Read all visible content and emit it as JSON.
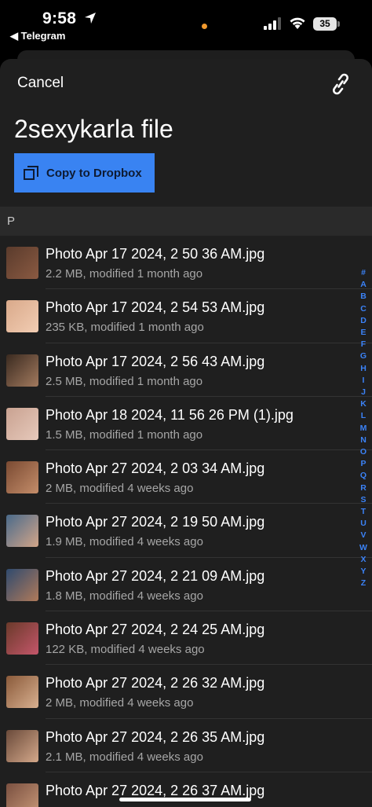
{
  "status_bar": {
    "time": "9:58",
    "back_app": "◀ Telegram",
    "battery": "35"
  },
  "header": {
    "cancel_label": "Cancel",
    "title": "2sexykarla file",
    "copy_button_label": "Copy to Dropbox"
  },
  "section": {
    "letter": "P"
  },
  "files": [
    {
      "name": "Photo Apr 17 2024, 2 50 36 AM.jpg",
      "meta": "2.2 MB, modified 1 month ago",
      "thumb": [
        "#5a3b2c",
        "#8a5a42"
      ]
    },
    {
      "name": "Photo Apr 17 2024, 2 54 53 AM.jpg",
      "meta": "235 KB, modified 1 month ago",
      "thumb": [
        "#d9a98a",
        "#f2cdb3"
      ]
    },
    {
      "name": "Photo Apr 17 2024, 2 56 43 AM.jpg",
      "meta": "2.5 MB, modified 1 month ago",
      "thumb": [
        "#3a2a20",
        "#a27a5e"
      ]
    },
    {
      "name": "Photo Apr 18 2024, 11 56 26 PM (1).jpg",
      "meta": "1.5 MB, modified 1 month ago",
      "thumb": [
        "#c9a291",
        "#e6c9bb"
      ]
    },
    {
      "name": "Photo Apr 27 2024, 2 03 34 AM.jpg",
      "meta": "2 MB, modified 4 weeks ago",
      "thumb": [
        "#7a4a32",
        "#c48d6a"
      ]
    },
    {
      "name": "Photo Apr 27 2024, 2 19 50 AM.jpg",
      "meta": "1.9 MB, modified 4 weeks ago",
      "thumb": [
        "#4a6a8a",
        "#d2a589"
      ]
    },
    {
      "name": "Photo Apr 27 2024, 2 21 09 AM.jpg",
      "meta": "1.8 MB, modified 4 weeks ago",
      "thumb": [
        "#2f4a6e",
        "#b07a5a"
      ]
    },
    {
      "name": "Photo Apr 27 2024, 2 24 25 AM.jpg",
      "meta": "122 KB, modified 4 weeks ago",
      "thumb": [
        "#6a3a2a",
        "#c4566a"
      ]
    },
    {
      "name": "Photo Apr 27 2024, 2 26 32 AM.jpg",
      "meta": "2 MB, modified 4 weeks ago",
      "thumb": [
        "#8a5a3a",
        "#d8b090"
      ]
    },
    {
      "name": "Photo Apr 27 2024, 2 26 35 AM.jpg",
      "meta": "2.1 MB, modified 4 weeks ago",
      "thumb": [
        "#6a4a3a",
        "#d4a88a"
      ]
    },
    {
      "name": "Photo Apr 27 2024, 2 26 37 AM.jpg",
      "meta": "",
      "thumb": [
        "#7a5040",
        "#c89878"
      ]
    }
  ],
  "index_letters": [
    "#",
    "A",
    "B",
    "C",
    "D",
    "E",
    "F",
    "G",
    "H",
    "I",
    "J",
    "K",
    "L",
    "M",
    "N",
    "O",
    "P",
    "Q",
    "R",
    "S",
    "T",
    "U",
    "V",
    "W",
    "X",
    "Y",
    "Z"
  ],
  "colors": {
    "accent": "#3983f2",
    "index": "#3b82f6",
    "background": "#1f1f1f",
    "section_header": "#2a2a2a"
  },
  "icons": {
    "location": "location-arrow-icon",
    "signal": "cellular-signal-icon",
    "wifi": "wifi-icon",
    "battery": "battery-icon",
    "link": "link-icon",
    "copy": "copy-icon"
  }
}
